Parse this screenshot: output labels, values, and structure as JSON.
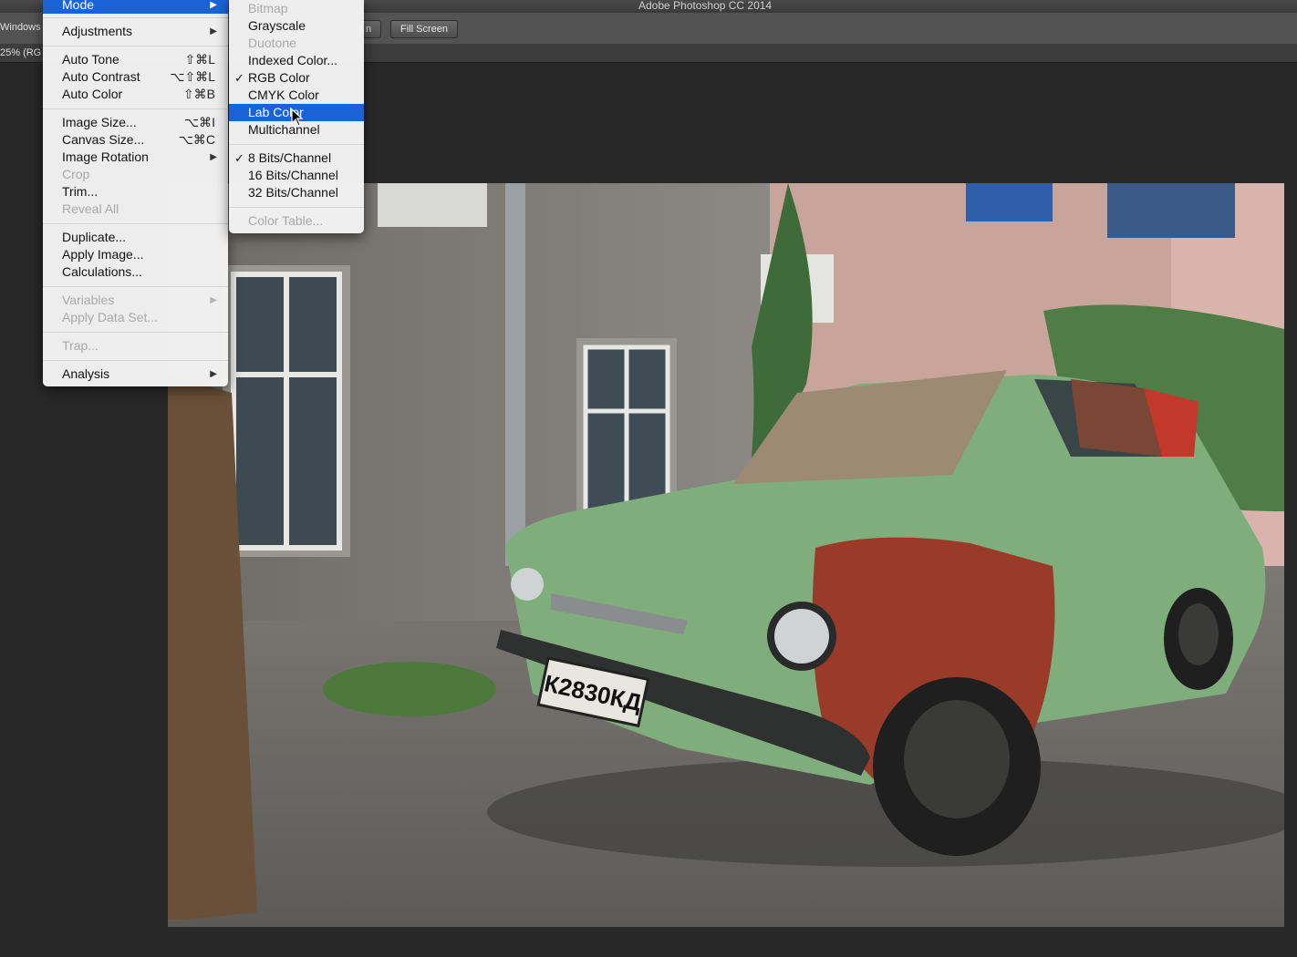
{
  "app": {
    "title": "Adobe Photoshop CC 2014"
  },
  "options_bar": {
    "windows_label": "Windows",
    "button_partial": "n",
    "fill_screen": "Fill Screen"
  },
  "tab": {
    "label": "25% (RG"
  },
  "image_menu": {
    "mode": "Mode",
    "adjustments": "Adjustments",
    "auto_tone": "Auto Tone",
    "auto_tone_sc": "⇧⌘L",
    "auto_contrast": "Auto Contrast",
    "auto_contrast_sc": "⌥⇧⌘L",
    "auto_color": "Auto Color",
    "auto_color_sc": "⇧⌘B",
    "image_size": "Image Size...",
    "image_size_sc": "⌥⌘I",
    "canvas_size": "Canvas Size...",
    "canvas_size_sc": "⌥⌘C",
    "image_rotation": "Image Rotation",
    "crop": "Crop",
    "trim": "Trim...",
    "reveal_all": "Reveal All",
    "duplicate": "Duplicate...",
    "apply_image": "Apply Image...",
    "calculations": "Calculations...",
    "variables": "Variables",
    "apply_data_set": "Apply Data Set...",
    "trap": "Trap...",
    "analysis": "Analysis"
  },
  "mode_menu": {
    "bitmap": "Bitmap",
    "grayscale": "Grayscale",
    "duotone": "Duotone",
    "indexed_color": "Indexed Color...",
    "rgb_color": "RGB Color",
    "cmyk_color": "CMYK Color",
    "lab_color": "Lab Color",
    "multichannel": "Multichannel",
    "bits8": "8 Bits/Channel",
    "bits16": "16 Bits/Channel",
    "bits32": "32 Bits/Channel",
    "color_table": "Color Table...",
    "check": "✓"
  },
  "photo": {
    "plate": "К2830КД"
  },
  "colors": {
    "menu_highlight": "#1a63d7",
    "car_green": "#7fae7c",
    "rust": "#9a3b2a"
  }
}
